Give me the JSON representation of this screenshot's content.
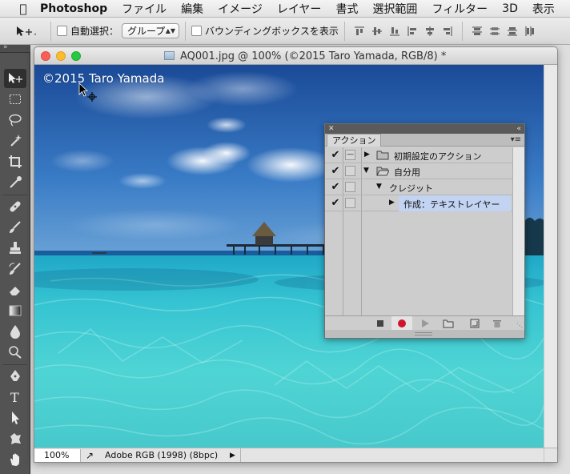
{
  "menubar": {
    "apple": "",
    "app": "Photoshop",
    "items": [
      "ファイル",
      "編集",
      "イメージ",
      "レイヤー",
      "書式",
      "選択範囲",
      "フィルター",
      "3D",
      "表示"
    ]
  },
  "options": {
    "auto_select_label": "自動選択：",
    "auto_select_value": "グループ",
    "show_transform_label": "バウンディングボックスを表示"
  },
  "document": {
    "title": "AQ001.jpg @ 100% (©2015 Taro Yamada, RGB/8) *",
    "watermark": "©2015 Taro Yamada",
    "zoom": "100%",
    "profile": "Adobe RGB (1998) (8bpc)"
  },
  "actions_panel": {
    "collapse": "✕",
    "expand": "«",
    "tab": "アクション",
    "rows": [
      {
        "label": "初期設定のアクション",
        "level": 0,
        "type": "set",
        "expanded": false,
        "checked": true,
        "dialog": true
      },
      {
        "label": "自分用",
        "level": 0,
        "type": "set",
        "expanded": true,
        "checked": true,
        "dialog": false
      },
      {
        "label": "クレジット",
        "level": 1,
        "type": "action",
        "expanded": true,
        "checked": true,
        "dialog": false
      },
      {
        "label": "作成：テキストレイヤー",
        "level": 2,
        "type": "command",
        "expanded": false,
        "checked": true,
        "dialog": false,
        "selected": true
      }
    ]
  },
  "colors": {
    "record": "#d0142c",
    "selection": "#c2d4f2",
    "tools_bg": "#535353"
  }
}
